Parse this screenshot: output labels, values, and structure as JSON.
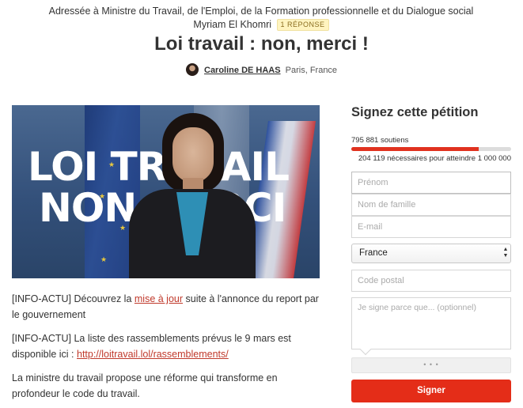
{
  "header": {
    "addressee_line": "Adressée à Ministre du Travail, de l'Emploi, de la Formation professionnelle et du Dialogue social Myriam El Khomri",
    "response_badge": "1 RÉPONSE",
    "title": "Loi travail : non, merci !",
    "author_name": "Caroline DE HAAS",
    "author_location": "Paris, France"
  },
  "hero": {
    "overlay_line1": "LOI TRAVAIL",
    "overlay_line2": "NON MERCI"
  },
  "article": {
    "p1_prefix": "[INFO-ACTU] Découvrez la ",
    "p1_link": "mise à jour",
    "p1_suffix": " suite à l'annonce du report par le gouvernement",
    "p2_text": "[INFO-ACTU] La liste des rassemblements prévus le 9 mars est disponible ici : ",
    "p2_link": "http://loitravail.lol/rassemblements/",
    "p3_text": "La ministre du travail propose une réforme qui transforme en profondeur le code du travail."
  },
  "sign": {
    "title": "Signez cette pétition",
    "supporters": "795 881 soutiens",
    "needed": "204 119 nécessaires pour atteindre 1 000 000",
    "progress": 0.796,
    "firstname_placeholder": "Prénom",
    "lastname_placeholder": "Nom de famille",
    "email_placeholder": "E-mail",
    "country_value": "France",
    "postal_placeholder": "Code postal",
    "reason_placeholder": "Je signe parce que... (optionnel)",
    "captcha_dots": "• • •",
    "button_label": "Signer"
  },
  "colors": {
    "accent": "#e42d18",
    "link": "#c0392b",
    "badge_bg": "#fff4bf"
  }
}
